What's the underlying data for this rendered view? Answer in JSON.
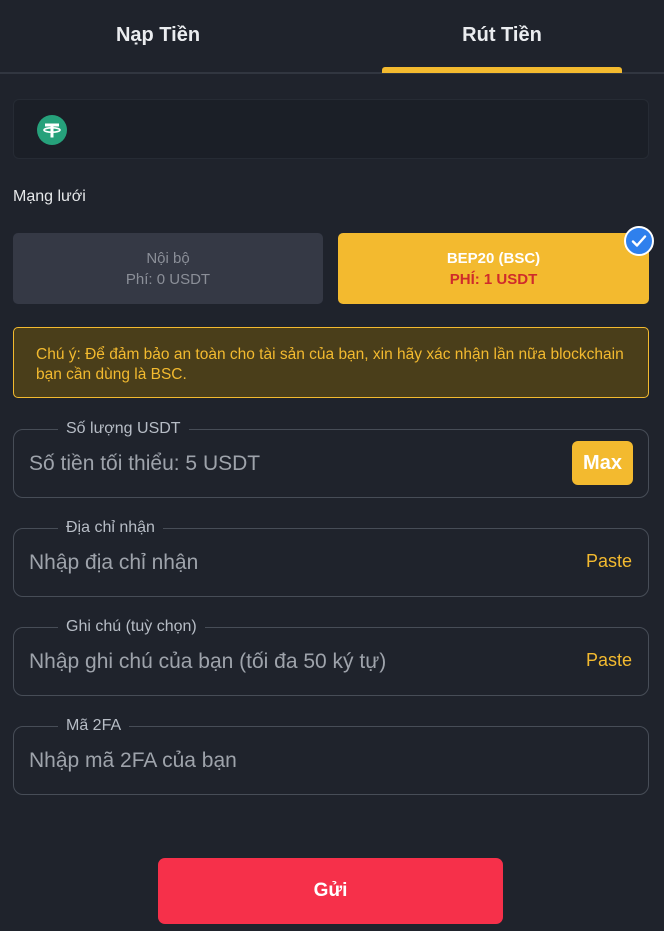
{
  "tabs": {
    "deposit": "Nạp Tiền",
    "withdraw": "Rút Tiền",
    "active": "withdraw"
  },
  "coin": {
    "icon": "tether-icon",
    "icon_color": "#26a17b"
  },
  "network": {
    "label": "Mạng lưới",
    "options": [
      {
        "name": "Nội bộ",
        "fee": "Phí: 0 USDT",
        "selected": false
      },
      {
        "name": "BEP20 (BSC)",
        "fee": "PHÍ: 1 USDT",
        "selected": true
      }
    ]
  },
  "notice": {
    "text": "Chú ý: Để đảm bảo an toàn cho tài sản của bạn, xin hãy xác nhận lần nữa blockchain bạn cần dùng là BSC."
  },
  "fields": {
    "amount": {
      "label": "Số lượng USDT",
      "placeholder": "Số tiền tối thiểu: 5 USDT",
      "value": "",
      "action": "Max"
    },
    "address": {
      "label": "Địa chỉ nhận",
      "placeholder": "Nhập địa chỉ nhận",
      "value": "",
      "action": "Paste"
    },
    "memo": {
      "label": "Ghi chú (tuỳ chọn)",
      "placeholder": "Nhập ghi chú của bạn (tối đa 50 ký tự)",
      "value": "",
      "action": "Paste"
    },
    "twofa": {
      "label": "Mã 2FA",
      "placeholder": "Nhập mã 2FA của bạn",
      "value": ""
    }
  },
  "submit_label": "Gửi",
  "colors": {
    "accent": "#f3ba2f",
    "danger": "#f6304a",
    "background": "#1f232c",
    "check": "#2f80ed"
  }
}
